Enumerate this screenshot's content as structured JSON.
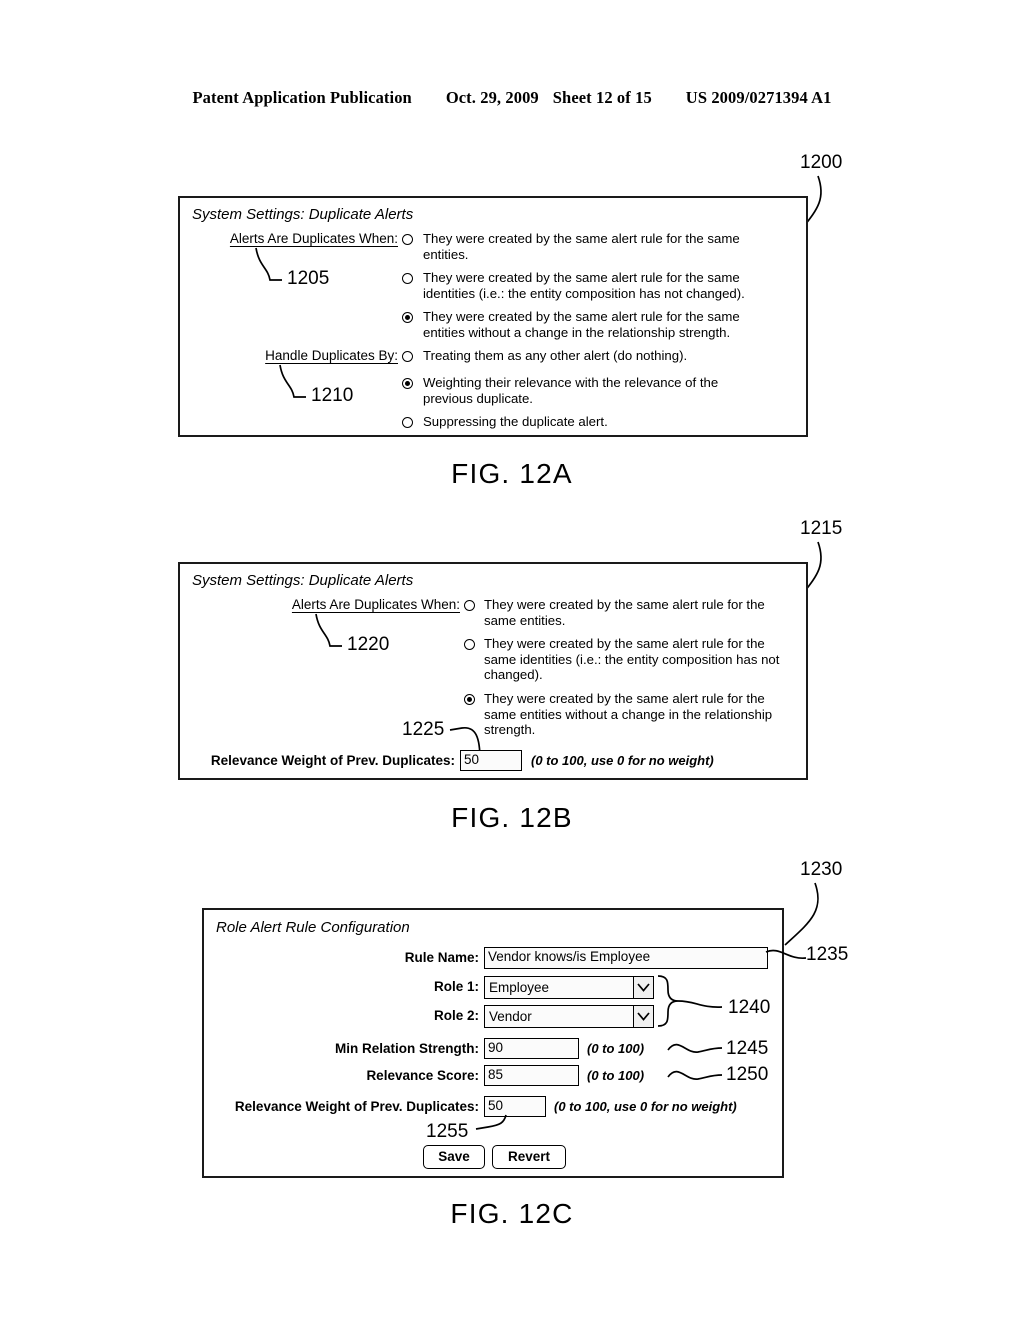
{
  "header": {
    "publication": "Patent Application Publication",
    "date": "Oct. 29, 2009",
    "sheet": "Sheet 12 of 15",
    "patent_number": "US 2009/0271394 A1"
  },
  "figures": [
    {
      "caption": "FIG. 12A",
      "ref": "1200",
      "title": "System Settings: Duplicate Alerts",
      "groups": [
        {
          "label": "Alerts Are Duplicates When:",
          "ref": "1205",
          "options": [
            {
              "selected": false,
              "text": "They were created by the same alert rule for the same entities."
            },
            {
              "selected": false,
              "text": "They were created by the same alert rule for the same identities (i.e.: the entity composition has not changed)."
            },
            {
              "selected": true,
              "text": "They were created by the same alert rule for the same entities without a change in the relationship strength."
            }
          ]
        },
        {
          "label": "Handle Duplicates By:",
          "ref": "1210",
          "options": [
            {
              "selected": false,
              "text": "Treating them as any other alert (do nothing)."
            },
            {
              "selected": true,
              "text": "Weighting their relevance with the relevance of the previous duplicate."
            },
            {
              "selected": false,
              "text": "Suppressing the duplicate alert."
            }
          ]
        }
      ]
    },
    {
      "caption": "FIG. 12B",
      "ref": "1215",
      "title": "System Settings: Duplicate Alerts",
      "group": {
        "label": "Alerts Are Duplicates When:",
        "ref": "1220",
        "options": [
          {
            "selected": false,
            "text": "They were created by the same alert rule for the same entities."
          },
          {
            "selected": false,
            "text": "They were created by the same alert rule for the same identities (i.e.: the entity composition has not changed)."
          },
          {
            "selected": true,
            "text": "They were created by the same alert rule for the same entities without a change in the relationship strength."
          }
        ]
      },
      "weight_field": {
        "label": "Relevance Weight of Prev. Duplicates:",
        "value": "50",
        "hint": "(0 to 100, use 0 for no weight)",
        "ref": "1225"
      }
    },
    {
      "caption": "FIG. 12C",
      "ref": "1230",
      "title": "Role Alert Rule Configuration",
      "fields": [
        {
          "label": "Rule Name:",
          "value": "Vendor knows/is Employee",
          "type": "text",
          "hint": "",
          "ref": "1235"
        },
        {
          "label": "Role 1:",
          "value": "Employee",
          "type": "select",
          "hint": "",
          "ref": ""
        },
        {
          "label": "Role 2:",
          "value": "Vendor",
          "type": "select",
          "hint": "",
          "ref": "1240"
        },
        {
          "label": "Min Relation Strength:",
          "value": "90",
          "type": "text",
          "hint": "(0 to 100)",
          "ref": "1245"
        },
        {
          "label": "Relevance Score:",
          "value": "85",
          "type": "text",
          "hint": "(0 to 100)",
          "ref": "1250"
        },
        {
          "label": "Relevance Weight of Prev. Duplicates:",
          "value": "50",
          "type": "text",
          "hint": "(0 to 100, use 0 for no weight)",
          "ref": "1255"
        }
      ],
      "buttons": [
        {
          "label": "Save"
        },
        {
          "label": "Revert"
        }
      ],
      "dropdown_icon": "chevron-down-icon"
    }
  ]
}
